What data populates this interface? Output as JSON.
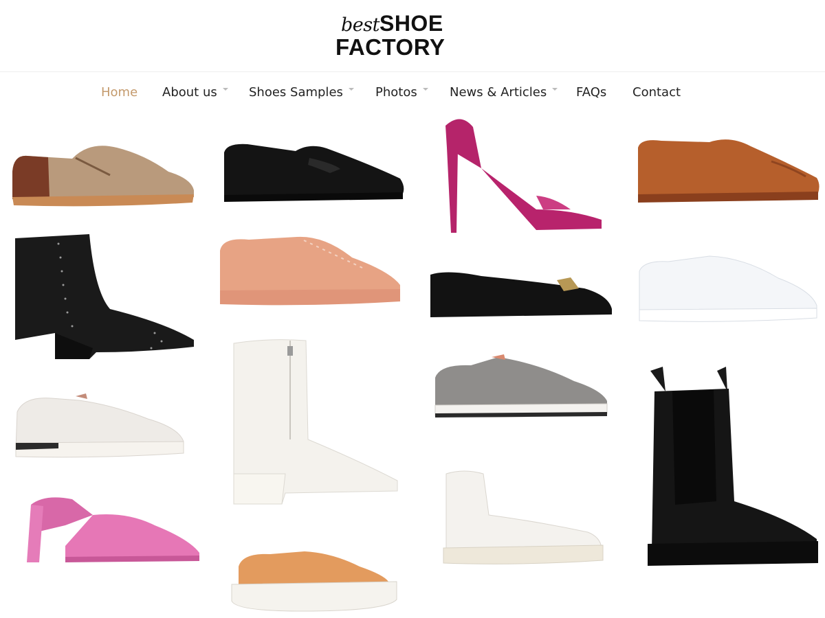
{
  "logo": {
    "best": "best",
    "shoe": "SHOE",
    "factory": "FACTORY"
  },
  "nav": {
    "items": [
      {
        "label": "Home",
        "active": true,
        "has_dropdown": false
      },
      {
        "label": "About us",
        "active": false,
        "has_dropdown": true
      },
      {
        "label": "Shoes Samples",
        "active": false,
        "has_dropdown": true
      },
      {
        "label": "Photos",
        "active": false,
        "has_dropdown": true
      },
      {
        "label": "News & Articles",
        "active": false,
        "has_dropdown": true
      },
      {
        "label": "FAQs",
        "active": false,
        "has_dropdown": false
      },
      {
        "label": "Contact",
        "active": false,
        "has_dropdown": false
      }
    ]
  },
  "colors": {
    "accent": "#c49a6c",
    "text": "#222222",
    "chevron": "#bbbbbb"
  },
  "gallery": {
    "products": [
      {
        "name": "brown-suede-derby-shoe"
      },
      {
        "name": "black-leather-penny-loafer"
      },
      {
        "name": "magenta-velvet-slingback-heel"
      },
      {
        "name": "tan-leather-oxford-shoe"
      },
      {
        "name": "black-studded-ankle-boot"
      },
      {
        "name": "rose-gold-metallic-sneaker"
      },
      {
        "name": "black-patent-ballet-flat"
      },
      {
        "name": "white-canvas-sneaker"
      },
      {
        "name": "white-suede-running-sneaker"
      },
      {
        "name": "white-leather-zip-boot"
      },
      {
        "name": "grey-suede-running-sneaker"
      },
      {
        "name": "black-chelsea-boot"
      },
      {
        "name": "pink-patent-mule-sandal"
      },
      {
        "name": "white-high-top-sneaker"
      },
      {
        "name": "orange-platform-sneaker"
      }
    ]
  }
}
